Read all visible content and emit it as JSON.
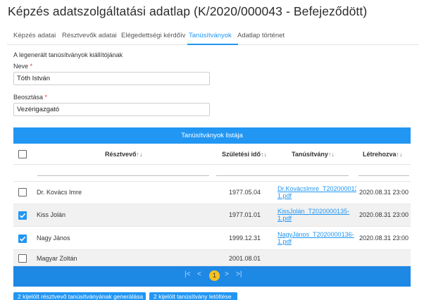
{
  "page": {
    "title": "Képzés adatszolgáltatási adatlap (K/2020/000043 - Befejeződött)"
  },
  "tabs": [
    {
      "label": "Képzés adatai"
    },
    {
      "label": "Résztvevők adatai"
    },
    {
      "label": "Elégedettségi kérdőív"
    },
    {
      "label": "Tanúsítványok",
      "active": true
    },
    {
      "label": "Adatlap történet"
    }
  ],
  "form": {
    "section_label": "A legenerált tanúsítványok kiállítójának",
    "name_label": "Neve",
    "name_value": "Tóth István",
    "position_label": "Beosztása",
    "position_value": "Vezérigazgató",
    "required_mark": "*"
  },
  "table": {
    "title": "Tanúsítványok listája",
    "columns": [
      {
        "label": "Résztvevő",
        "sort": "↑↓"
      },
      {
        "label": "Születési idő",
        "sort": "↑↓"
      },
      {
        "label": "Tanúsítvány",
        "sort": "↑↓"
      },
      {
        "label": "Létrehozva",
        "sort": "↑↓"
      }
    ],
    "rows": [
      {
        "checked": false,
        "name": "Dr. Kovács Imre",
        "birth": "1977.05.04",
        "cert_line1": "Dr.KovácsImre_T202000013(",
        "cert_line2": "1.pdf",
        "created": "2020.08.31 23:00"
      },
      {
        "checked": true,
        "name": "Kiss Jolán",
        "birth": "1977.01.01",
        "cert_line1": "KissJolán_T2020000135-",
        "cert_line2": "1.pdf",
        "created": "2020.08.31 23:00"
      },
      {
        "checked": true,
        "name": "Nagy János",
        "birth": "1999.12.31",
        "cert_line1": "NagyJános_T2020000136-",
        "cert_line2": "1.pdf",
        "created": "2020.08.31 23:00"
      },
      {
        "checked": false,
        "name": "Magyar Zoltán",
        "birth": "2001.08.01",
        "cert_line1": "",
        "cert_line2": "",
        "created": ""
      }
    ]
  },
  "paginator": {
    "first": "|<",
    "prev": "<",
    "current_page": "1",
    "next": ">",
    "last": ">|"
  },
  "buttons": {
    "generate": "2 kijelölt résztvevő tanúsítványának generálása",
    "download": "2 kijelölt tanúsítvány letöltése"
  },
  "colors": {
    "accent": "#2196f3",
    "paginator": "#1e88e5",
    "active_page": "#f7c21e",
    "required": "#e53935"
  }
}
